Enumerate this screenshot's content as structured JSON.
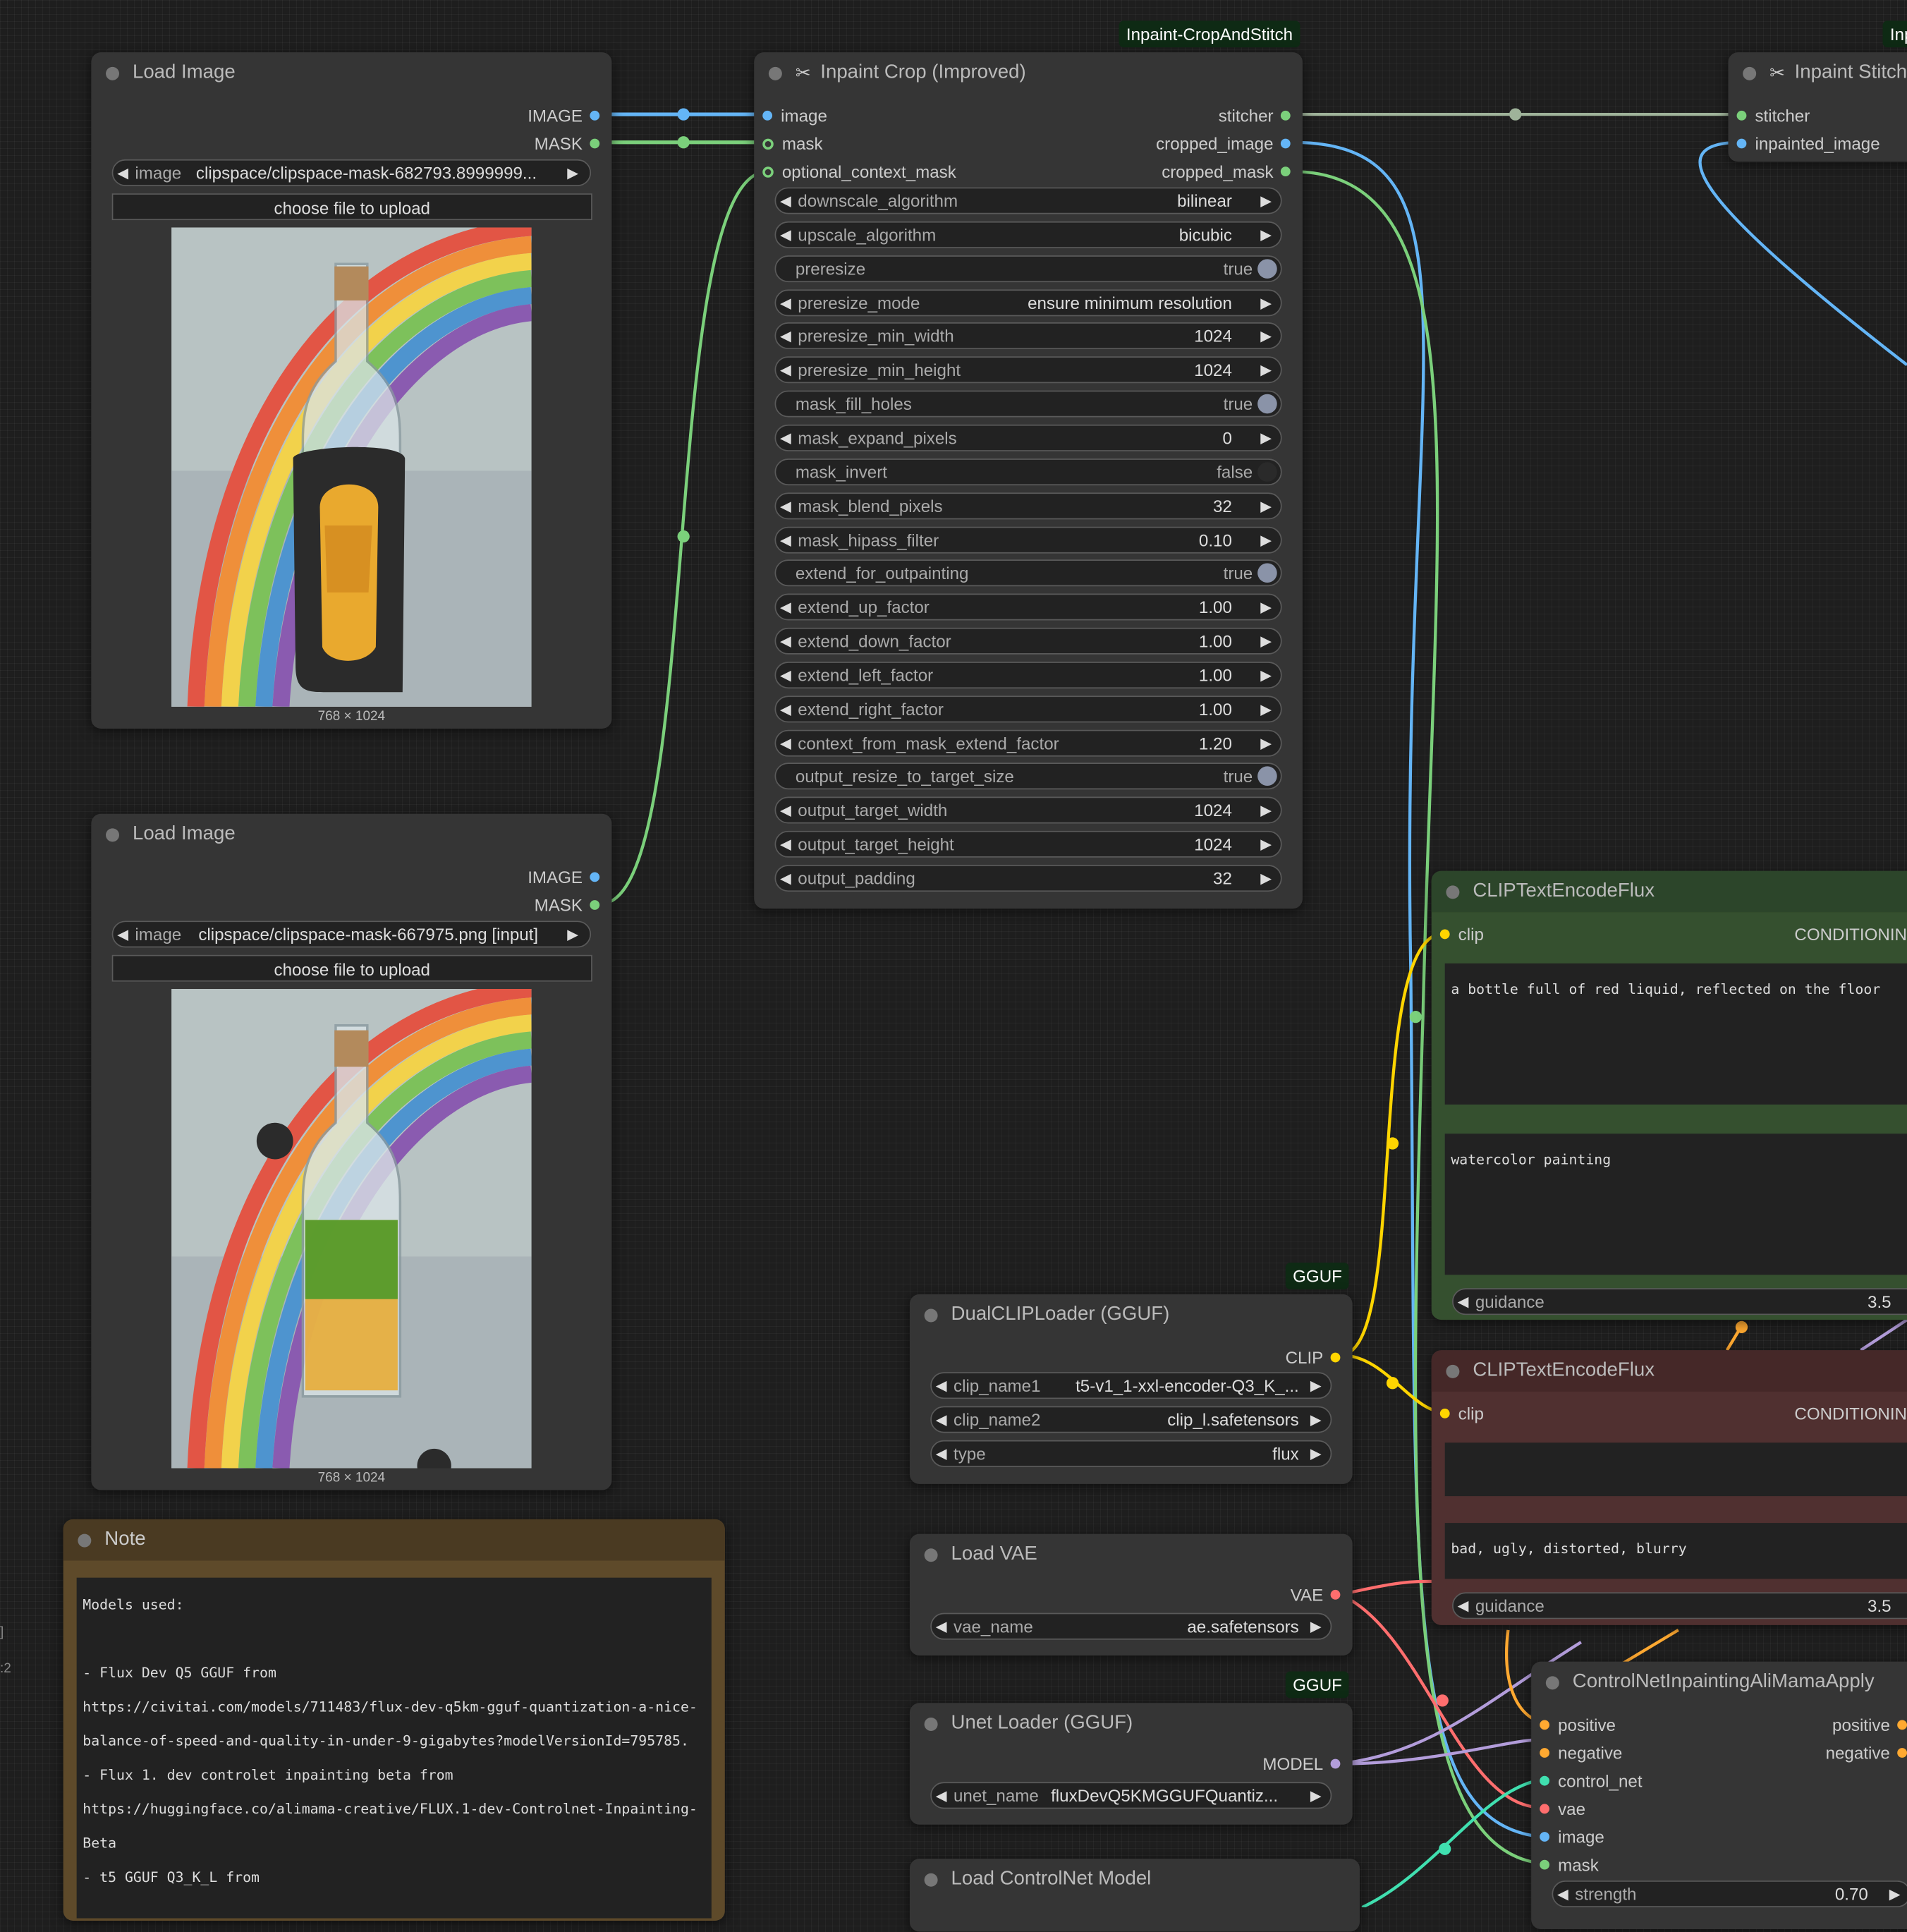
{
  "load_image_1": {
    "title": "Load Image",
    "outputs": [
      "IMAGE",
      "MASK"
    ],
    "image_label": "image",
    "image_value": "clipspace/clipspace-mask-682793.8999999...",
    "upload_button": "choose file to upload",
    "dimensions": "768 × 1024"
  },
  "load_image_2": {
    "title": "Load Image",
    "outputs": [
      "IMAGE",
      "MASK"
    ],
    "image_label": "image",
    "image_value": "clipspace/clipspace-mask-667975.png [input]",
    "upload_button": "choose file to upload",
    "dimensions": "768 × 1024"
  },
  "note": {
    "title": "Note",
    "text": "Models used:\n\n- Flux Dev Q5 GGUF from\nhttps://civitai.com/models/711483/flux-dev-q5km-gguf-quantization-a-nice-balance-of-speed-and-quality-in-under-9-gigabytes?modelVersionId=795785.\n- Flux 1. dev controlet inpainting beta from\nhttps://huggingface.co/alimama-creative/FLUX.1-dev-Controlnet-Inpainting-Beta\n- t5 GGUF Q3_K_L from"
  },
  "inpaint_crop": {
    "badge": "Inpaint-CropAndStitch",
    "title": "Inpaint Crop (Improved)",
    "inputs": [
      "image",
      "mask",
      "optional_context_mask"
    ],
    "outputs": [
      "stitcher",
      "cropped_image",
      "cropped_mask"
    ],
    "widgets": [
      {
        "label": "downscale_algorithm",
        "value": "bilinear",
        "kind": "combo"
      },
      {
        "label": "upscale_algorithm",
        "value": "bicubic",
        "kind": "combo"
      },
      {
        "label": "preresize",
        "value": "true",
        "kind": "toggle"
      },
      {
        "label": "preresize_mode",
        "value": "ensure minimum resolution",
        "kind": "combo"
      },
      {
        "label": "preresize_min_width",
        "value": "1024",
        "kind": "number"
      },
      {
        "label": "preresize_min_height",
        "value": "1024",
        "kind": "number"
      },
      {
        "label": "mask_fill_holes",
        "value": "true",
        "kind": "toggle"
      },
      {
        "label": "mask_expand_pixels",
        "value": "0",
        "kind": "number"
      },
      {
        "label": "mask_invert",
        "value": "false",
        "kind": "toggle"
      },
      {
        "label": "mask_blend_pixels",
        "value": "32",
        "kind": "number"
      },
      {
        "label": "mask_hipass_filter",
        "value": "0.10",
        "kind": "number"
      },
      {
        "label": "extend_for_outpainting",
        "value": "true",
        "kind": "toggle"
      },
      {
        "label": "extend_up_factor",
        "value": "1.00",
        "kind": "number"
      },
      {
        "label": "extend_down_factor",
        "value": "1.00",
        "kind": "number"
      },
      {
        "label": "extend_left_factor",
        "value": "1.00",
        "kind": "number"
      },
      {
        "label": "extend_right_factor",
        "value": "1.00",
        "kind": "number"
      },
      {
        "label": "context_from_mask_extend_factor",
        "value": "1.20",
        "kind": "number"
      },
      {
        "label": "output_resize_to_target_size",
        "value": "true",
        "kind": "toggle"
      },
      {
        "label": "output_target_width",
        "value": "1024",
        "kind": "number"
      },
      {
        "label": "output_target_height",
        "value": "1024",
        "kind": "number"
      },
      {
        "label": "output_padding",
        "value": "32",
        "kind": "number"
      }
    ]
  },
  "inpaint_stitch": {
    "badge": "Inp",
    "title": "Inpaint Stitch",
    "inputs": [
      "stitcher",
      "inpainted_image"
    ]
  },
  "clip_text_positive": {
    "title": "CLIPTextEncodeFlux",
    "input": "clip",
    "output": "CONDITIONIN",
    "text_clip_l": "a bottle full of red liquid, reflected on the floor",
    "text_t5": "watercolor painting",
    "guidance_label": "guidance",
    "guidance_value": "3.5"
  },
  "clip_text_negative": {
    "title": "CLIPTextEncodeFlux",
    "input": "clip",
    "output": "CONDITIONIN",
    "text_clip_l": "",
    "text_t5": "bad, ugly, distorted, blurry",
    "guidance_label": "guidance",
    "guidance_value": "3.5"
  },
  "dual_clip": {
    "badge": "GGUF",
    "title": "DualCLIPLoader (GGUF)",
    "output": "CLIP",
    "widgets": [
      {
        "label": "clip_name1",
        "value": "t5-v1_1-xxl-encoder-Q3_K_..."
      },
      {
        "label": "clip_name2",
        "value": "clip_l.safetensors"
      },
      {
        "label": "type",
        "value": "flux"
      }
    ]
  },
  "load_vae": {
    "title": "Load VAE",
    "output": "VAE",
    "widget": {
      "label": "vae_name",
      "value": "ae.safetensors"
    }
  },
  "unet_loader": {
    "badge": "GGUF",
    "title": "Unet Loader (GGUF)",
    "output": "MODEL",
    "widget": {
      "label": "unet_name",
      "value": "fluxDevQ5KMGGUFQuantiz..."
    }
  },
  "load_controlnet": {
    "title": "Load ControlNet Model"
  },
  "controlnet_apply": {
    "title": "ControlNetInpaintingAliMamaApply",
    "inputs": [
      "positive",
      "negative",
      "control_net",
      "vae",
      "image",
      "mask"
    ],
    "outputs": [
      "positive",
      "negative"
    ],
    "widget": {
      "label": "strength",
      "value": "0.70"
    }
  },
  "colors": {
    "image": "#64b5f6",
    "mask": "#7bd07b",
    "clip": "#ffd500",
    "vae": "#ff6e6e",
    "model": "#b39ddb",
    "conditioning": "#ffa931",
    "control_net": "#40e0b0",
    "clip_positive_node": "#35502f",
    "clip_negative_node": "#503030",
    "note_node": "#5e4a2a"
  }
}
